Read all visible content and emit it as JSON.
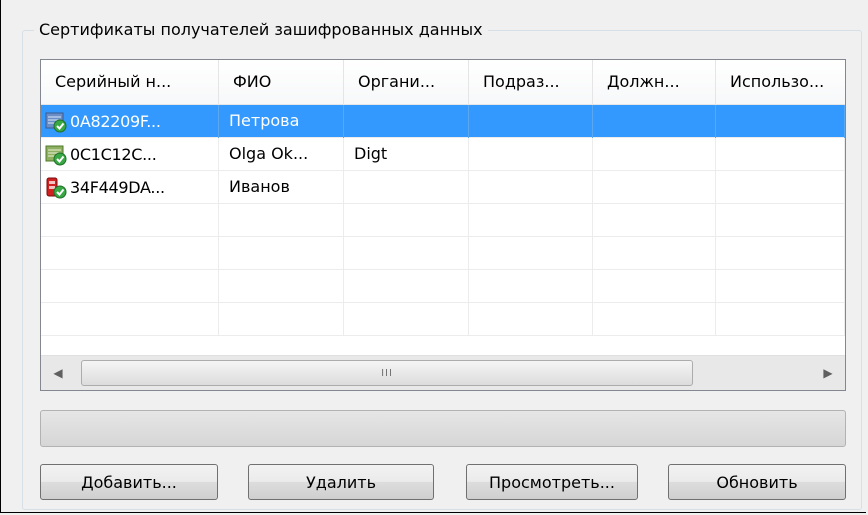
{
  "groupbox": {
    "title": "Сертификаты получателей зашифрованных данных"
  },
  "table": {
    "columns": [
      "Серийный н...",
      "ФИО",
      "Органи...",
      "Подраз...",
      "Должн...",
      "Использо..."
    ],
    "rows": [
      {
        "serial": "0A82209F...",
        "fio": "Петрова",
        "org": "",
        "dept": "",
        "position": "",
        "usage": "",
        "selected": true,
        "icon": "certificate-valid-icon"
      },
      {
        "serial": "0C1C12C...",
        "fio": "Olga Ok...",
        "org": "Digt",
        "dept": "",
        "position": "",
        "usage": "",
        "selected": false,
        "icon": "certificate-valid-icon"
      },
      {
        "serial": "34F449DA...",
        "fio": "Иванов",
        "org": "",
        "dept": "",
        "position": "",
        "usage": "",
        "selected": false,
        "icon": "certificate-token-icon"
      }
    ]
  },
  "scrollbar": {
    "thumb_grip": "III",
    "left_arrow": "◀",
    "right_arrow": "▶"
  },
  "progress": {
    "value": 0
  },
  "buttons": {
    "add": "Добавить...",
    "delete": "Удалить",
    "view": "Просмотреть...",
    "refresh": "Обновить"
  },
  "colors": {
    "selection": "#3399ff",
    "window_bg": "#f0f0f0"
  }
}
